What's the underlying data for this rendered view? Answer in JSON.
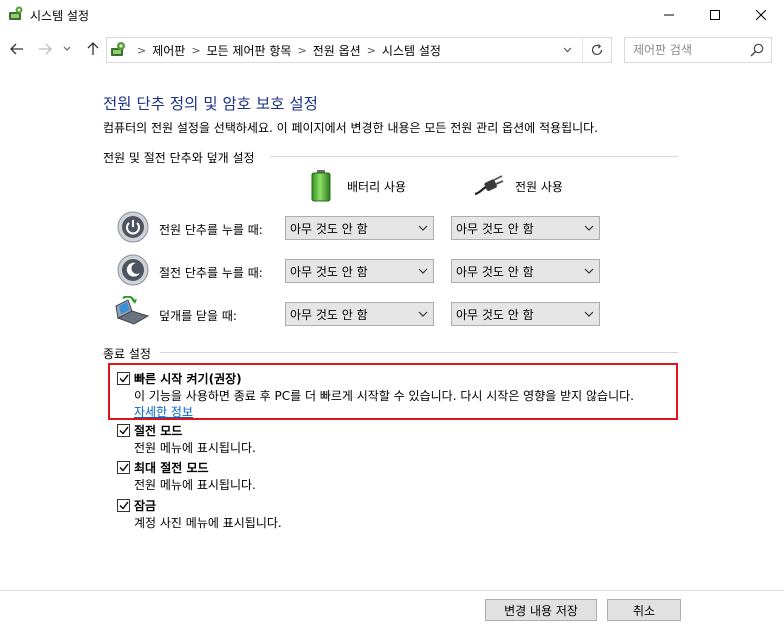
{
  "window": {
    "title": "시스템 설정"
  },
  "addressbar": {
    "breadcrumbs": [
      "제어판",
      "모든 제어판 항목",
      "전원 옵션",
      "시스템 설정"
    ]
  },
  "search": {
    "placeholder": "제어판 검색"
  },
  "main": {
    "title": "전원 단추 정의 및 암호 보호 설정",
    "description": "컴퓨터의 전원 설정을 선택하세요. 이 페이지에서 변경한 내용은 모든 전원 관리 옵션에 적용됩니다.",
    "power_group_label": "전원 및 절전 단추와 덮개 설정",
    "columns": {
      "battery": "배터리 사용",
      "plugged_in": "전원 사용"
    },
    "rows": [
      {
        "label": "전원 단추를 누를 때:",
        "battery": "아무 것도 안 함",
        "plugged_in": "아무 것도 안 함"
      },
      {
        "label": "절전 단추를 누를 때:",
        "battery": "아무 것도 안 함",
        "plugged_in": "아무 것도 안 함"
      },
      {
        "label": "덮개를 닫을 때:",
        "battery": "아무 것도 안 함",
        "plugged_in": "아무 것도 안 함"
      }
    ],
    "shutdown_group_label": "종료 설정",
    "shutdown_options": [
      {
        "title": "빠른 시작 켜기(권장)",
        "description": "이 기능을 사용하면 종료 후 PC를 더 빠르게 시작할 수 있습니다. 다시 시작은 영향을 받지 않습니다.",
        "link": "자세한 정보",
        "checked": true
      },
      {
        "title": "절전 모드",
        "description": "전원 메뉴에 표시됩니다.",
        "checked": true
      },
      {
        "title": "최대 절전 모드",
        "description": "전원 메뉴에 표시됩니다.",
        "checked": true
      },
      {
        "title": "잠금",
        "description": "계정 사진 메뉴에 표시됩니다.",
        "checked": true
      }
    ]
  },
  "footer": {
    "save_label": "변경 내용 저장",
    "cancel_label": "취소"
  },
  "colors": {
    "title": "#1e3287",
    "link": "#0066cc",
    "highlight": "#e3121e"
  }
}
